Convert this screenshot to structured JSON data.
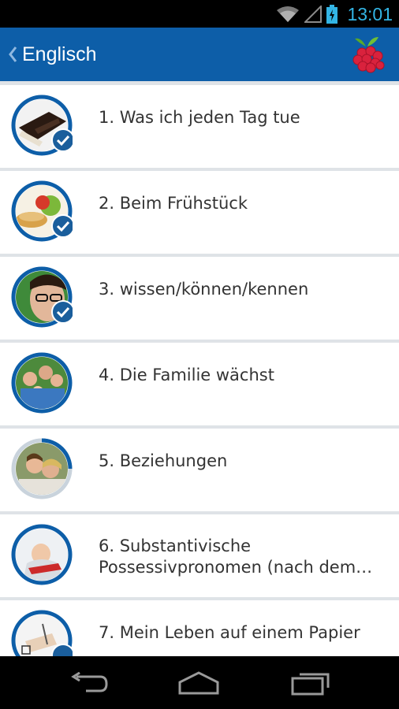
{
  "status_bar": {
    "time": "13:01",
    "battery_color": "#33b5e5"
  },
  "app_bar": {
    "title": "Englisch",
    "background": "#0d5ea8"
  },
  "lessons": [
    {
      "label": "1. Was ich jeden Tag tue",
      "completed": true,
      "progress": 1.0
    },
    {
      "label": "2. Beim Frühstück",
      "completed": true,
      "progress": 1.0
    },
    {
      "label": "3. wissen/können/kennen",
      "completed": true,
      "progress": 1.0
    },
    {
      "label": "4. Die Familie wächst",
      "completed": false,
      "progress": 1.0
    },
    {
      "label": "5. Beziehungen",
      "completed": false,
      "progress": 0.25
    },
    {
      "label": "6. Substantivische\nPossessivpronomen (nach dem…",
      "completed": false,
      "progress": 1.0
    },
    {
      "label": "7. Mein Leben auf einem Papier",
      "completed": false,
      "progress": 1.0
    }
  ],
  "icons": {
    "back": "chevron-left-icon",
    "logo": "raspberry-icon",
    "nav_back": "back-arrow-icon",
    "nav_home": "home-icon",
    "nav_recent": "recent-apps-icon"
  },
  "colors": {
    "accent": "#0d5ea8",
    "ring_track": "#c9d3dc",
    "check_badge": "#1a5e9c"
  }
}
